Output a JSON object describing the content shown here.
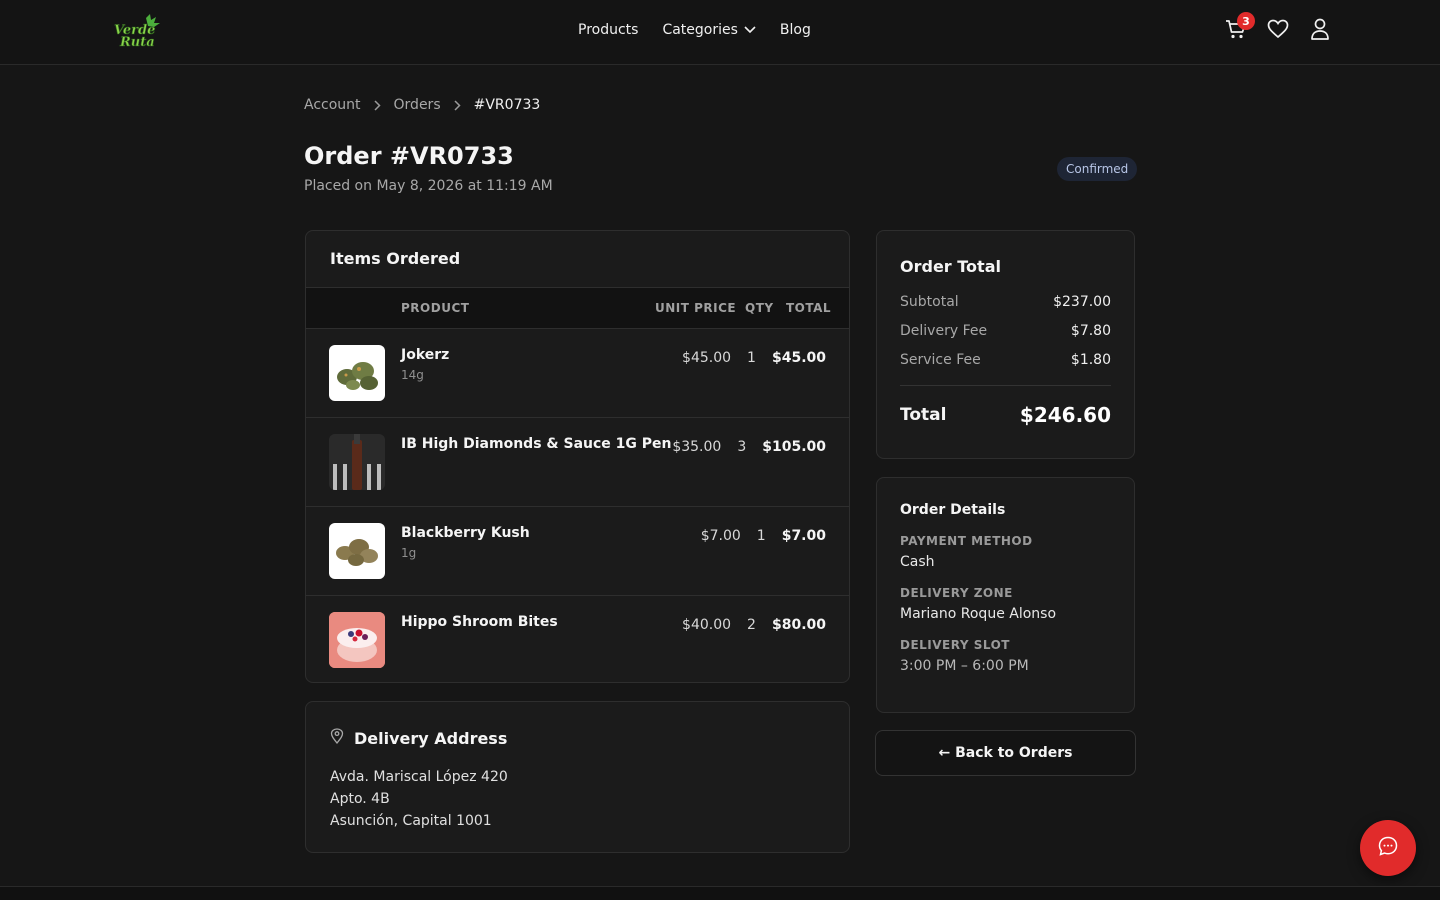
{
  "header": {
    "logo_text": "Verde Ruta",
    "nav": [
      {
        "label": "Products"
      },
      {
        "label": "Categories"
      },
      {
        "label": "Blog"
      }
    ],
    "cart_count": "3",
    "icons": [
      "cart-icon",
      "heart-icon",
      "user-icon",
      "chevron-down-icon"
    ]
  },
  "breadcrumb": {
    "items": [
      "Account",
      "Orders",
      "#VR0733"
    ]
  },
  "order": {
    "title": "Order #VR0733",
    "placed": "Placed on May 8, 2026 at 11:19 AM",
    "status": "Confirmed"
  },
  "items_card": {
    "heading": "Items Ordered",
    "columns": {
      "product": "PRODUCT",
      "unit_price": "UNIT PRICE",
      "qty": "QTY",
      "total": "TOTAL"
    },
    "rows": [
      {
        "name": "Jokerz",
        "variant": "14g",
        "unit": "$45.00",
        "qty": "1",
        "total": "$45.00"
      },
      {
        "name": "IB High Diamonds & Sauce 1G Pen",
        "variant": "",
        "unit": "$35.00",
        "qty": "3",
        "total": "$105.00"
      },
      {
        "name": "Blackberry Kush",
        "variant": "1g",
        "unit": "$7.00",
        "qty": "1",
        "total": "$7.00"
      },
      {
        "name": "Hippo Shroom Bites",
        "variant": "",
        "unit": "$40.00",
        "qty": "2",
        "total": "$80.00"
      }
    ]
  },
  "address": {
    "heading": "Delivery Address",
    "lines": [
      "Avda. Mariscal López 420",
      "Apto. 4B",
      "Asunción, Capital 1001"
    ]
  },
  "totals": {
    "heading": "Order Total",
    "subtotal_label": "Subtotal",
    "subtotal": "$237.00",
    "delivery_label": "Delivery Fee",
    "delivery": "$7.80",
    "service_label": "Service Fee",
    "service": "$1.80",
    "total_label": "Total",
    "total": "$246.60"
  },
  "details": {
    "heading": "Order Details",
    "payment_label": "PAYMENT METHOD",
    "payment": "Cash",
    "zone_label": "DELIVERY ZONE",
    "zone": "Mariano Roque Alonso",
    "slot_label": "DELIVERY SLOT",
    "slot": "3:00 PM – 6:00 PM"
  },
  "back_button": "← Back to Orders",
  "colors": {
    "accent": "#e12b2b",
    "background": "#161616",
    "card": "#1b1b1b"
  }
}
